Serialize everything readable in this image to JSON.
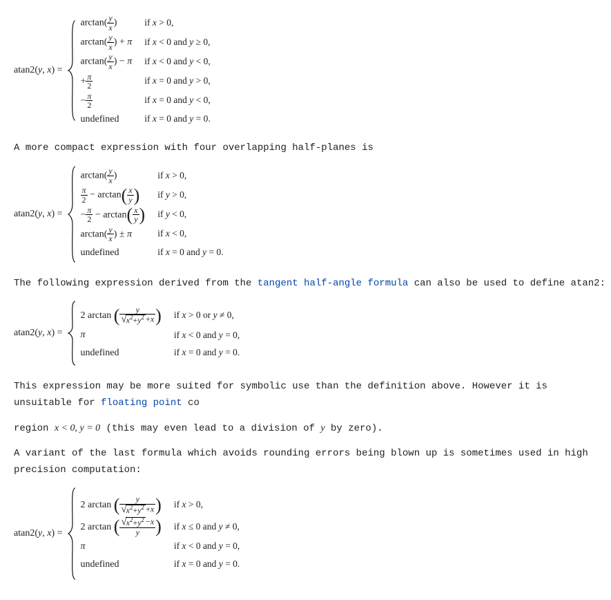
{
  "eq1": {
    "lhs_fn": "atan2",
    "lhs_args": "(y, x) =",
    "cases": [
      {
        "expr_html": "arctan(<span class='frac'><span class='n it'>y</span><span class='d it'>x</span></span>)",
        "cond": "if x > 0,"
      },
      {
        "expr_html": "arctan(<span class='frac'><span class='n it'>y</span><span class='d it'>x</span></span>) + <span class='it'>π</span>",
        "cond": "if x < 0 and y ≥ 0,"
      },
      {
        "expr_html": "arctan(<span class='frac'><span class='n it'>y</span><span class='d it'>x</span></span>) − <span class='it'>π</span>",
        "cond": "if x < 0 and y < 0,"
      },
      {
        "expr_html": "+<span class='frac'><span class='n it'>π</span><span class='d'>2</span></span>",
        "cond": "if x = 0 and y > 0,"
      },
      {
        "expr_html": "−<span class='frac'><span class='n it'>π</span><span class='d'>2</span></span>",
        "cond": "if x = 0 and y < 0,"
      },
      {
        "expr_html": "undefined",
        "cond": "if x = 0 and y = 0."
      }
    ]
  },
  "p1": "A more compact expression with four overlapping half-planes is",
  "eq2": {
    "lhs_fn": "atan2",
    "lhs_args": "(y, x) =",
    "cases": [
      {
        "expr_html": "arctan(<span class='frac'><span class='n it'>y</span><span class='d it'>x</span></span>)",
        "cond": "if x > 0,"
      },
      {
        "expr_html": "<span class='frac'><span class='n it'>π</span><span class='d'>2</span></span> − arctan<span class='big'>(</span><span class='frac'><span class='n it'>x</span><span class='d it'>y</span></span><span class='big'>)</span>",
        "cond": "if y > 0,"
      },
      {
        "expr_html": "−<span class='frac'><span class='n it'>π</span><span class='d'>2</span></span> − arctan<span class='big'>(</span><span class='frac'><span class='n it'>x</span><span class='d it'>y</span></span><span class='big'>)</span>",
        "cond": "if y < 0,"
      },
      {
        "expr_html": "arctan(<span class='frac'><span class='n it'>y</span><span class='d it'>x</span></span>) ± <span class='it'>π</span>",
        "cond": "if x < 0,"
      },
      {
        "expr_html": "undefined",
        "cond": "if x = 0 and y = 0."
      }
    ]
  },
  "p2a": "The following expression derived from the ",
  "p2link": "tangent half-angle formula",
  "p2b": " can also be used to define ",
  "p2code": "atan2",
  "p2c": ":",
  "eq3": {
    "lhs_fn": "atan2",
    "lhs_args": "(y, x) =",
    "cases": [
      {
        "expr_html": "2 arctan <span class='big'>(</span><span class='frac'><span class='n it'>y</span><span class='d'><span class='sqrt'><span class='rad'><span class='it'>x</span><sup>2</sup>+<span class='it'>y</span><sup>2</sup></span></span>+<span class='it'>x</span></span></span><span class='big'>)</span>",
        "cond": "if x > 0 or y ≠ 0,"
      },
      {
        "expr_html": "<span class='it'>π</span>",
        "cond": "if x < 0 and y = 0,"
      },
      {
        "expr_html": "undefined",
        "cond": "if x = 0 and y = 0."
      }
    ]
  },
  "p3a": "This expression may be more suited for symbolic use than the definition above. However it is unsuitable for ",
  "p3link": "floating point",
  "p3b": " co",
  "p4a": "region ",
  "p4code": "x < 0, y = 0",
  "p4b": " (this may even lead to a division of ",
  "p4it": "y",
  "p4c": " by zero).",
  "p5": "A variant of the last formula which avoids rounding errors being blown up is sometimes used in high precision computation:",
  "eq4": {
    "lhs_fn": "atan2",
    "lhs_args": "(y, x) =",
    "cases": [
      {
        "expr_html": "2 arctan <span class='big'>(</span><span class='frac'><span class='n it'>y</span><span class='d'><span class='sqrt'><span class='rad'><span class='it'>x</span><sup>2</sup>+<span class='it'>y</span><sup>2</sup></span></span>+<span class='it'>x</span></span></span><span class='big'>)</span>",
        "cond": "if x > 0,"
      },
      {
        "expr_html": "2 arctan <span class='big'>(</span><span class='frac'><span class='n'><span class='sqrt'><span class='rad'><span class='it'>x</span><sup>2</sup>+<span class='it'>y</span><sup>2</sup></span></span>−<span class='it'>x</span></span><span class='d it'>y</span></span><span class='big'>)</span>",
        "cond": "if x ≤ 0 and y ≠ 0,"
      },
      {
        "expr_html": "<span class='it'>π</span>",
        "cond": "if x < 0 and y = 0,"
      },
      {
        "expr_html": "undefined",
        "cond": "if x = 0 and y = 0."
      }
    ]
  }
}
